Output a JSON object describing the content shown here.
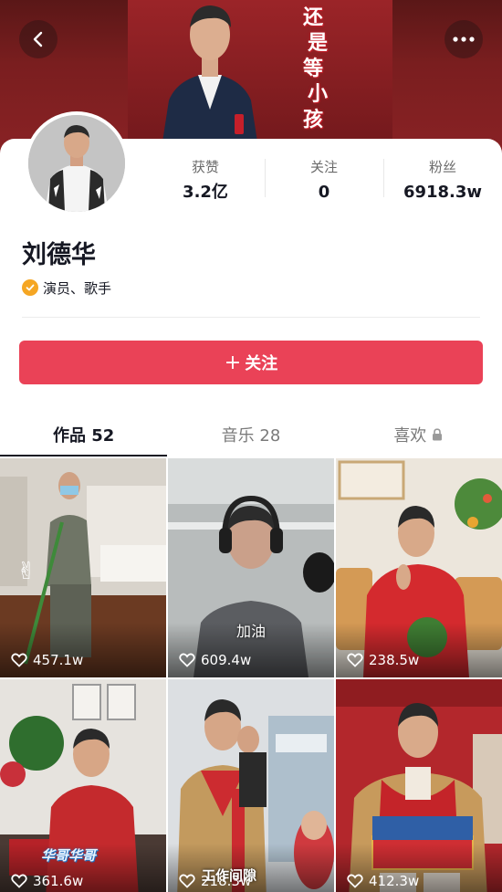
{
  "header": {
    "banner_title_chars": [
      "还",
      "是",
      "等",
      "小",
      "孩"
    ],
    "back_icon": "chevron-left-icon",
    "more_icon": "more-dots-icon"
  },
  "profile": {
    "stats": [
      {
        "label": "获赞",
        "value": "3.2亿"
      },
      {
        "label": "关注",
        "value": "0"
      },
      {
        "label": "粉丝",
        "value": "6918.3w"
      }
    ],
    "name": "刘德华",
    "verify_text": "演员、歌手",
    "verify_icon": "verified-badge-icon",
    "follow_label": "关注",
    "follow_plus": "+"
  },
  "tabs": [
    {
      "label": "作品 52",
      "active": true
    },
    {
      "label": "音乐 28",
      "active": false
    },
    {
      "label": "喜欢",
      "active": false,
      "icon": "lock-icon"
    }
  ],
  "videos": [
    {
      "likes": "457.1w",
      "caption": ""
    },
    {
      "likes": "609.4w",
      "caption": "加油"
    },
    {
      "likes": "238.5w",
      "caption": ""
    },
    {
      "likes": "361.6w",
      "caption": "华哥华哥"
    },
    {
      "likes": "218.3w",
      "caption": "工作间隙"
    },
    {
      "likes": "412.3w",
      "caption": ""
    }
  ],
  "colors": {
    "accent": "#ea4257",
    "banner": "#7a1e1f",
    "verify": "#f5a623",
    "text": "#161823"
  }
}
